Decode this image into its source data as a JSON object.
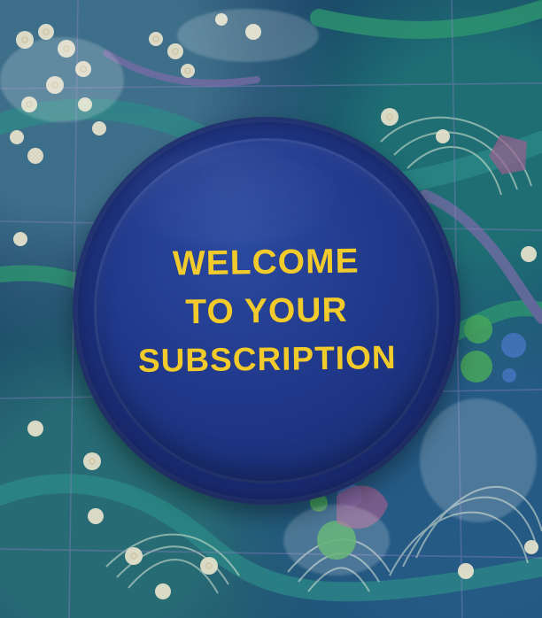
{
  "lid_message": {
    "line1": "WELCOME",
    "line2": "TO YOUR",
    "line3": "SUBSCRIPTION"
  },
  "colors": {
    "background": "#1b3f63",
    "fabric_teal": "#2d8a88",
    "fabric_green": "#2f9b6f",
    "fabric_purple": "#7b6ba8",
    "sequin_cream": "#e9e4cd",
    "lid_blue": "#1f3687",
    "text_yellow": "#f1ca2c"
  }
}
